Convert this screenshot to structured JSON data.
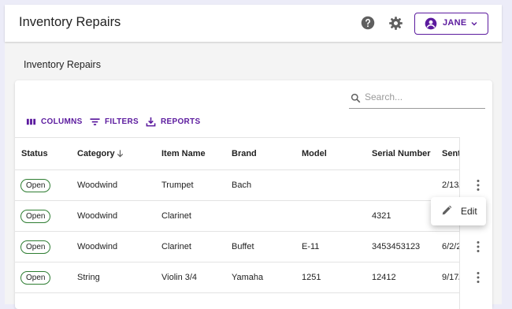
{
  "app": {
    "title": "Inventory Repairs"
  },
  "header": {
    "help_icon": "help-circle-icon",
    "settings_icon": "gear-icon",
    "user": {
      "name": "JANE",
      "avatar_icon": "account-circle-icon",
      "chevron": "chevron-down-icon"
    }
  },
  "page": {
    "heading": "Inventory Repairs"
  },
  "search": {
    "placeholder": "Search...",
    "value": ""
  },
  "toolbar": {
    "columns_label": "COLUMNS",
    "filters_label": "FILTERS",
    "reports_label": "REPORTS"
  },
  "table": {
    "columns": [
      "Status",
      "Category",
      "Item Name",
      "Brand",
      "Model",
      "Serial Number",
      "Sent"
    ],
    "rows": [
      {
        "status": "Open",
        "category": "Woodwind",
        "item": "Trumpet",
        "brand": "Bach",
        "model": "",
        "serial": "",
        "sent": "2/13/"
      },
      {
        "status": "Open",
        "category": "Woodwind",
        "item": "Clarinet",
        "brand": "",
        "model": "",
        "serial": "4321",
        "sent": ""
      },
      {
        "status": "Open",
        "category": "Woodwind",
        "item": "Clarinet",
        "brand": "Buffet",
        "model": "E-11",
        "serial": "3453453123",
        "sent": "6/2/2"
      },
      {
        "status": "Open",
        "category": "String",
        "item": "Violin 3/4",
        "brand": "Yamaha",
        "model": "1251",
        "serial": "12412",
        "sent": "9/17/"
      }
    ]
  },
  "context_menu": {
    "edit_label": "Edit",
    "edit_icon": "pencil-icon"
  },
  "colors": {
    "accent": "#5b1a9e",
    "chip_border": "#2e7d32",
    "background": "#ececf8"
  }
}
